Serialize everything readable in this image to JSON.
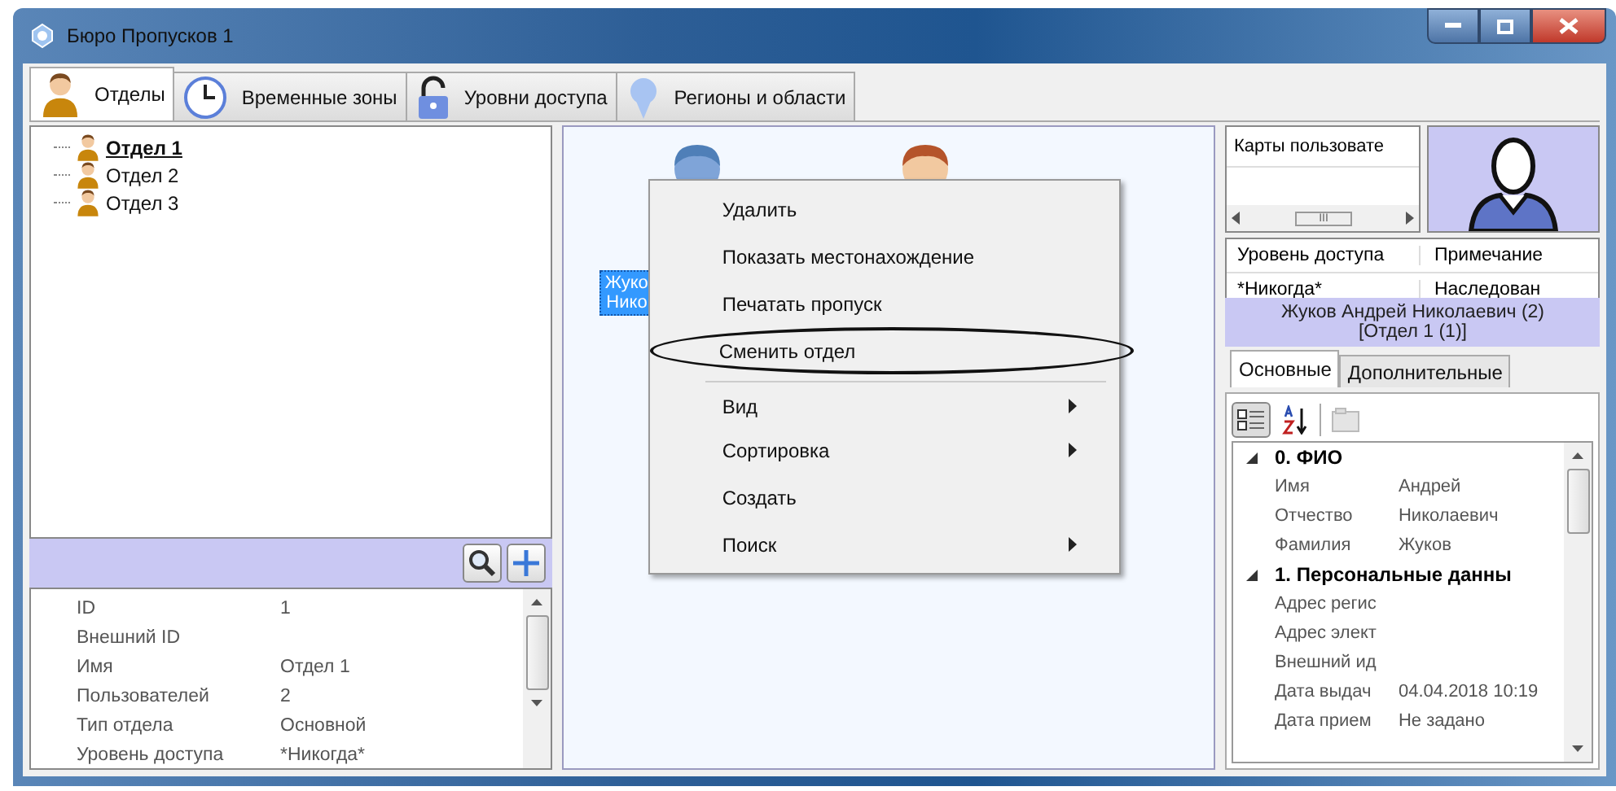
{
  "window": {
    "title": "Бюро Пропусков 1"
  },
  "tabs": [
    {
      "label": "Отделы",
      "selected": true
    },
    {
      "label": "Временные зоны",
      "selected": false
    },
    {
      "label": "Уровни доступа",
      "selected": false
    },
    {
      "label": "Регионы и области",
      "selected": false
    }
  ],
  "department_tree": {
    "items": [
      {
        "label": "Отдел 1",
        "selected": true
      },
      {
        "label": "Отдел 2",
        "selected": false
      },
      {
        "label": "Отдел 3",
        "selected": false
      }
    ]
  },
  "department_properties": {
    "rows": [
      {
        "name": "ID",
        "value": "1"
      },
      {
        "name": "Внешний ID"
      },
      {
        "name": "Имя",
        "value": "Отдел 1"
      },
      {
        "name": "Пользователей",
        "value": "2"
      },
      {
        "name": "Тип отдела",
        "value": "Основной"
      },
      {
        "name": "Уровень доступа",
        "value": "*Никогда*"
      }
    ]
  },
  "persons": [
    {
      "label_lines": [
        "Жуко",
        "Нико"
      ],
      "selected": true
    },
    {
      "selected": false
    }
  ],
  "context_menu": {
    "items": [
      {
        "label": "Удалить",
        "submenu": false,
        "separator_before": false,
        "circled": false
      },
      {
        "label": "Показать местонахождение",
        "submenu": false,
        "separator_before": false,
        "circled": false
      },
      {
        "label": "Печатать пропуск",
        "submenu": false,
        "separator_before": false,
        "circled": false
      },
      {
        "label": "Сменить отдел",
        "submenu": false,
        "separator_before": false,
        "circled": true
      },
      {
        "label": "Вид",
        "submenu": true,
        "separator_before": true,
        "circled": false
      },
      {
        "label": "Сортировка",
        "submenu": true,
        "separator_before": false,
        "circled": false
      },
      {
        "label": "Создать",
        "submenu": false,
        "separator_before": false,
        "circled": false
      },
      {
        "label": "Поиск",
        "submenu": true,
        "separator_before": false,
        "circled": false
      }
    ]
  },
  "cards_table": {
    "column_1": "Карты пользовате",
    "scroll_thumb": "III"
  },
  "access_table": {
    "columns": [
      "Уровень доступа",
      "Примечание"
    ],
    "rows": [
      [
        "*Никогда*",
        "Наследован"
      ]
    ]
  },
  "person_header": {
    "name": "Жуков Андрей Николаевич (2)",
    "department": "[Отдел 1 (1)]"
  },
  "detail_tabs": [
    {
      "label": "Основные",
      "selected": true
    },
    {
      "label": "Дополнительные",
      "selected": false
    }
  ],
  "property_grid": {
    "categories": [
      {
        "title": "0. ФИО",
        "expanded": true,
        "rows": [
          {
            "name": "Имя",
            "value": "Андрей"
          },
          {
            "name": "Отчество",
            "value": "Николаевич"
          },
          {
            "name": "Фамилия",
            "value": "Жуков"
          }
        ]
      },
      {
        "title": "1. Персональные данны",
        "expanded": true,
        "rows": [
          {
            "name": "Адрес регис"
          },
          {
            "name": "Адрес элект"
          },
          {
            "name": "Внешний ид"
          },
          {
            "name": "Дата выдач",
            "value": "04.04.2018 10:19"
          },
          {
            "name": "Дата прием",
            "value": "Не задано"
          }
        ]
      }
    ]
  }
}
